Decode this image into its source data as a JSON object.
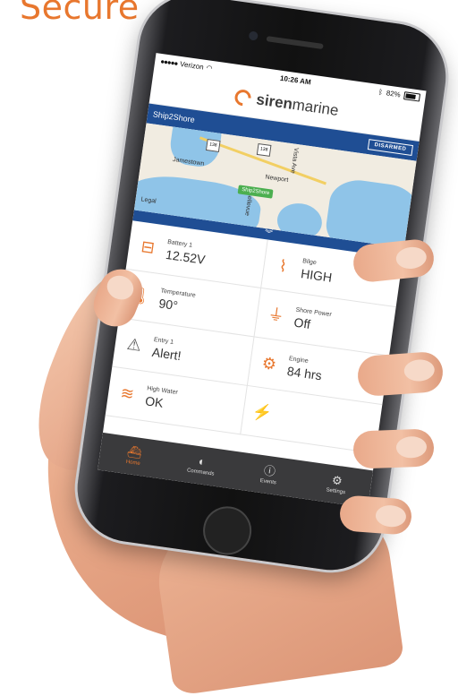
{
  "headline": "Secure",
  "status_bar": {
    "carrier": "Verizon",
    "time": "10:26 AM",
    "battery": "82%"
  },
  "app": {
    "logo_bold": "siren",
    "logo_light": "marine"
  },
  "ship": {
    "title": "Ship2Shore",
    "status": "DISARMED"
  },
  "map": {
    "labels": [
      "Jamestown",
      "Newport",
      "Bellevue",
      "Vista Ave",
      "Legal"
    ],
    "shields": [
      "138",
      "138"
    ],
    "pin": "Ship2Shore"
  },
  "tiles": [
    {
      "label": "Battery 1",
      "value": "12.52V",
      "icon": "battery-icon"
    },
    {
      "label": "Bilge",
      "value": "HIGH",
      "icon": "bilge-pump-icon"
    },
    {
      "label": "Temperature",
      "value": "90°",
      "icon": "thermometer-icon"
    },
    {
      "label": "Shore Power",
      "value": "Off",
      "icon": "plug-icon"
    },
    {
      "label": "Entry 1",
      "value": "Alert!",
      "icon": "warning-icon"
    },
    {
      "label": "Engine",
      "value": "84 hrs",
      "icon": "engine-icon"
    },
    {
      "label": "High Water",
      "value": "OK",
      "icon": "water-level-icon"
    },
    {
      "label": "",
      "value": "",
      "icon": "add-sensor-icon"
    }
  ],
  "tabs": [
    {
      "label": "Home",
      "icon": "boat-icon"
    },
    {
      "label": "Commands",
      "icon": "toggle-icon"
    },
    {
      "label": "Events",
      "icon": "alert-circle-icon"
    },
    {
      "label": "Settings",
      "icon": "gear-icon"
    }
  ],
  "colors": {
    "accent": "#e8772e",
    "navy": "#1f4e94",
    "tabbar": "#3a3a3c"
  }
}
